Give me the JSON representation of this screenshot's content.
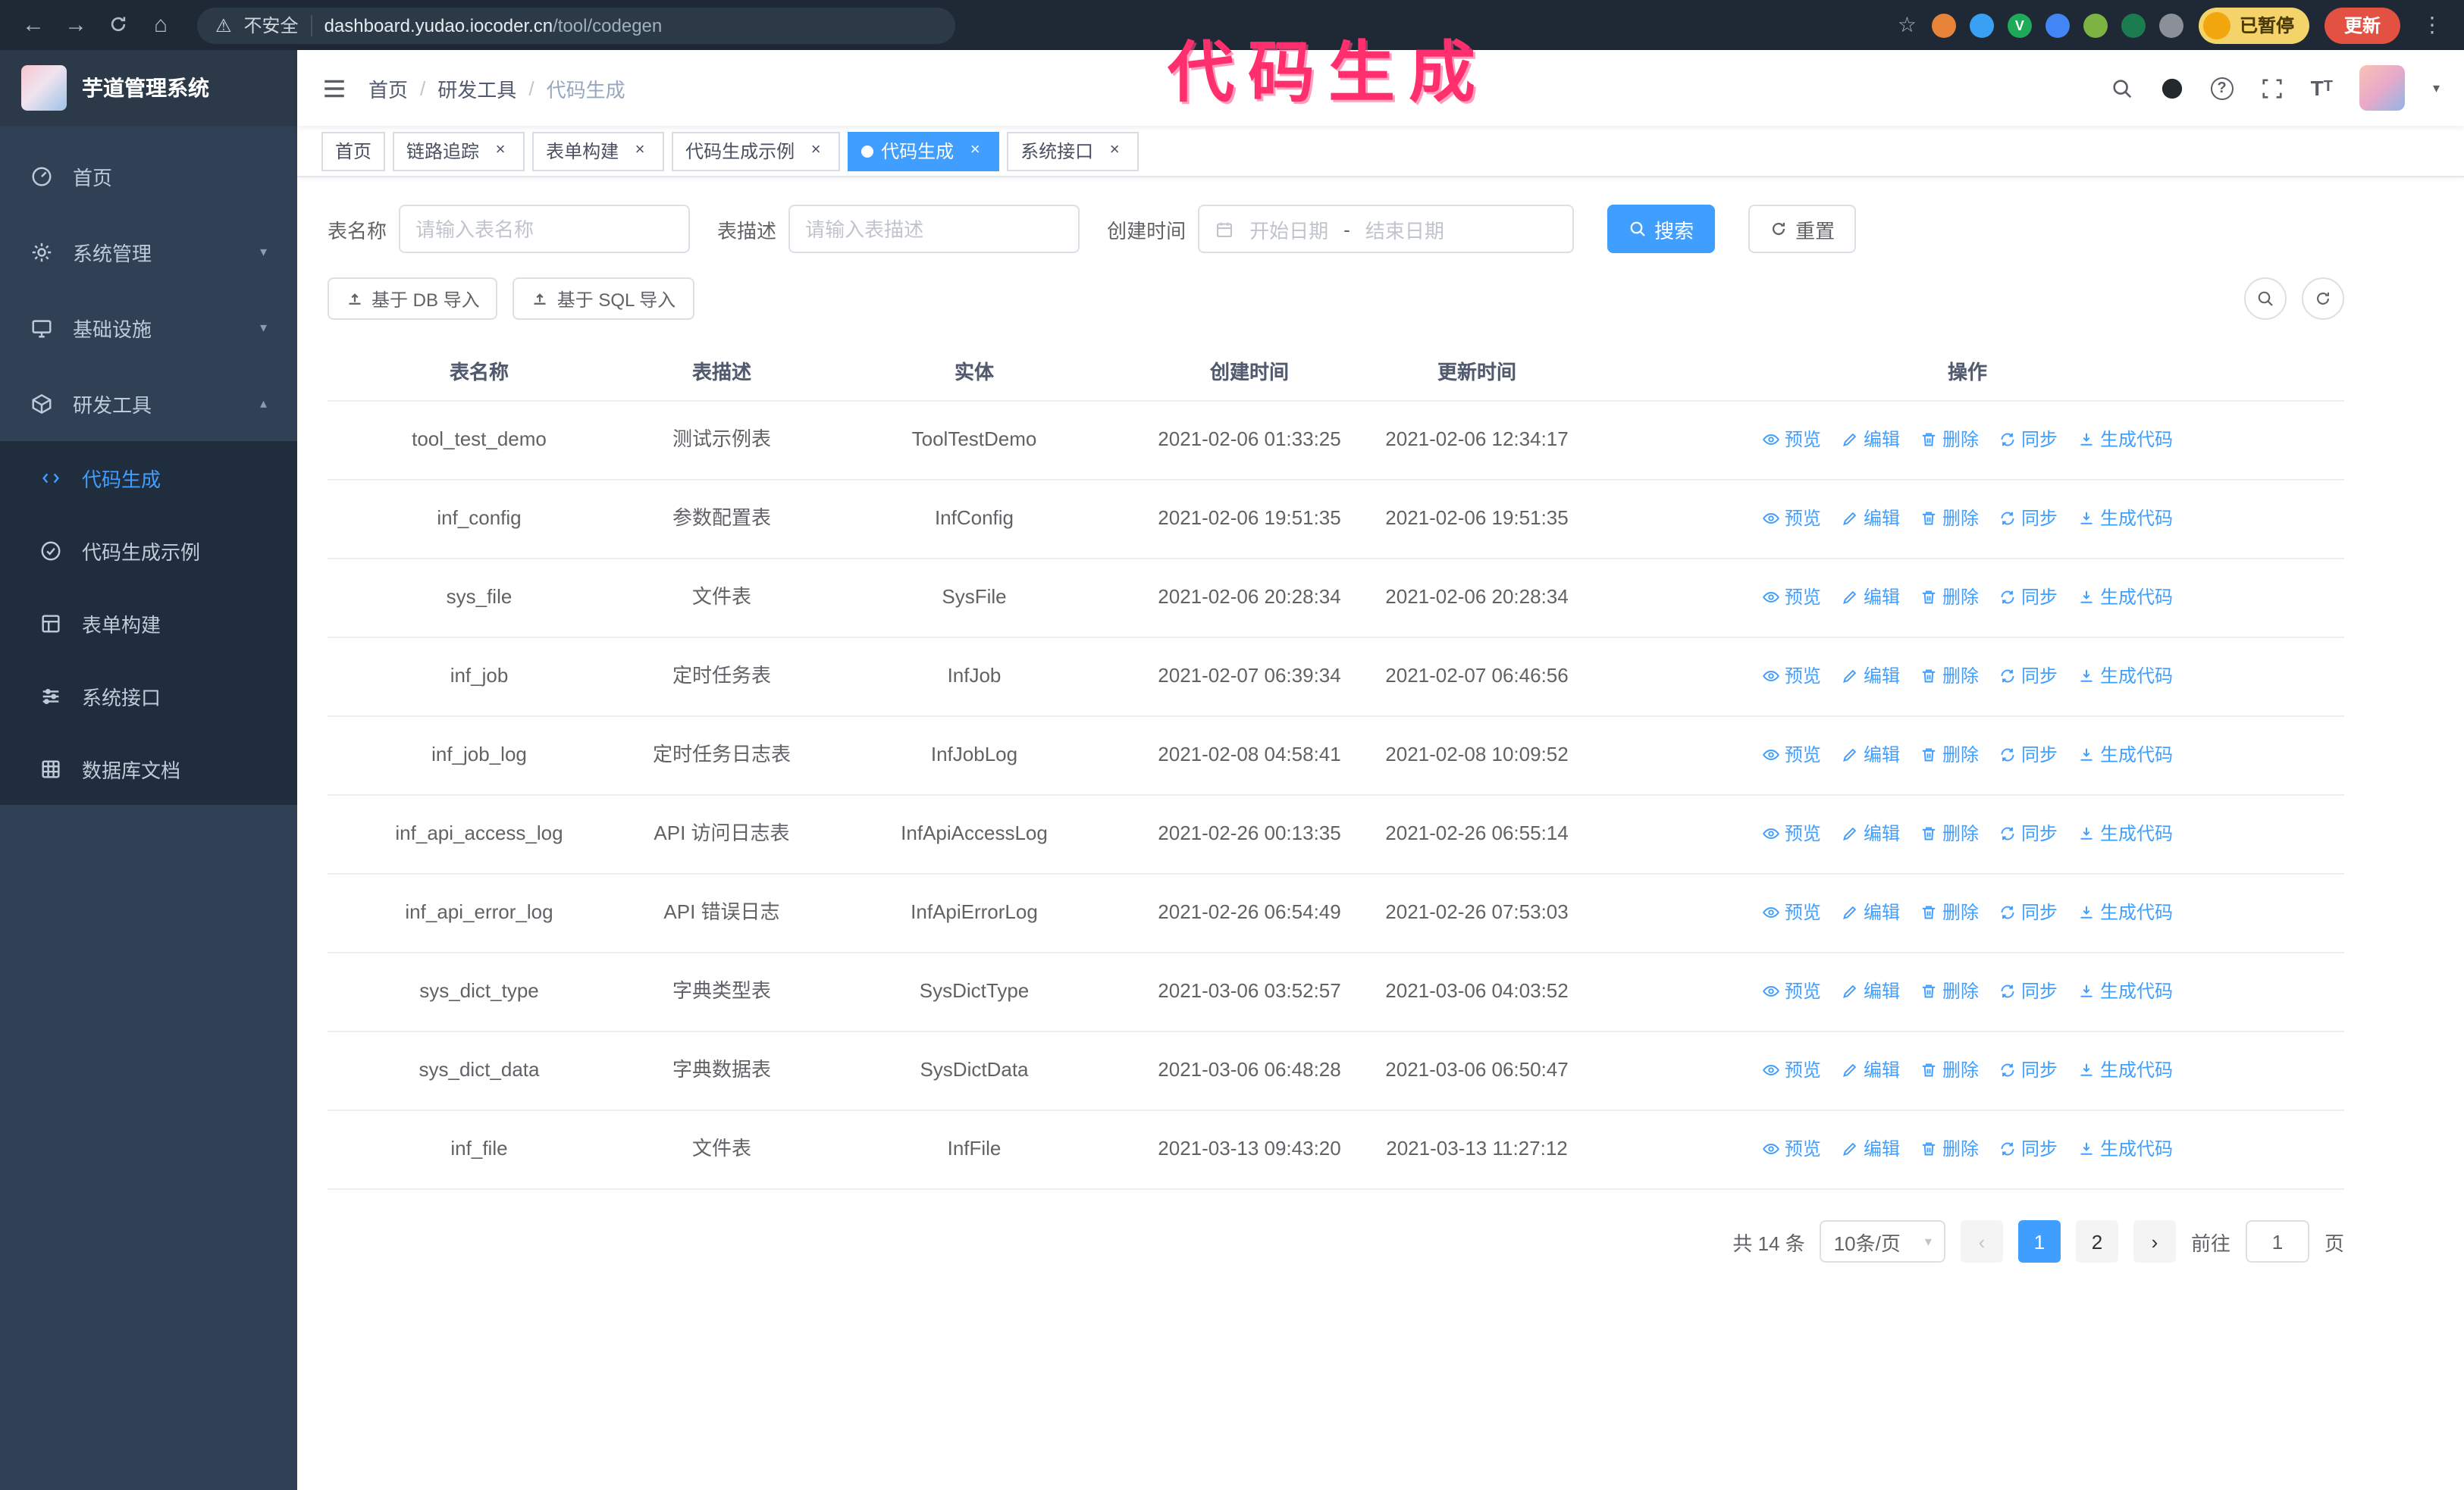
{
  "browser": {
    "security_label": "不安全",
    "url_domain": "dashboard.yudao.iocoder.cn",
    "url_path": "/tool/codegen",
    "extensions": [
      {
        "name": "extension-icon-1",
        "color": "#e8833a",
        "glyph": ""
      },
      {
        "name": "extension-icon-2",
        "color": "#3aa0f3",
        "glyph": ""
      },
      {
        "name": "extension-icon-3",
        "color": "#1faa59",
        "glyph": "V"
      },
      {
        "name": "extension-icon-4",
        "color": "#4285f4",
        "glyph": ""
      },
      {
        "name": "extension-icon-5",
        "color": "#7cb342",
        "glyph": ""
      },
      {
        "name": "extension-icon-6",
        "color": "#1b7d4f",
        "glyph": ""
      },
      {
        "name": "extension-icon-7",
        "color": "#8a8f98",
        "glyph": ""
      }
    ],
    "paused_badge": "已暂停",
    "update_button": "更新"
  },
  "annotation": {
    "title": "代码生成",
    "color": "#ff2f6e"
  },
  "sidebar": {
    "logo_title": "芋道管理系统",
    "items": [
      {
        "label": "首页"
      },
      {
        "label": "系统管理"
      },
      {
        "label": "基础设施"
      },
      {
        "label": "研发工具"
      }
    ],
    "subitems": [
      {
        "label": "代码生成"
      },
      {
        "label": "代码生成示例"
      },
      {
        "label": "表单构建"
      },
      {
        "label": "系统接口"
      },
      {
        "label": "数据库文档"
      }
    ]
  },
  "header": {
    "breadcrumb": [
      "首页",
      "研发工具",
      "代码生成"
    ]
  },
  "tabs": [
    {
      "label": "首页"
    },
    {
      "label": "链路追踪"
    },
    {
      "label": "表单构建"
    },
    {
      "label": "代码生成示例"
    },
    {
      "label": "代码生成"
    },
    {
      "label": "系统接口"
    }
  ],
  "filters": {
    "table_name_label": "表名称",
    "table_name_placeholder": "请输入表名称",
    "table_desc_label": "表描述",
    "table_desc_placeholder": "请输入表描述",
    "create_time_label": "创建时间",
    "date_start_placeholder": "开始日期",
    "date_separator": "-",
    "date_end_placeholder": "结束日期",
    "search_button": "搜索",
    "reset_button": "重置"
  },
  "toolbar": {
    "import_db": "基于 DB 导入",
    "import_sql": "基于 SQL 导入"
  },
  "table": {
    "columns": [
      "表名称",
      "表描述",
      "实体",
      "创建时间",
      "更新时间",
      "操作"
    ],
    "actions": [
      "预览",
      "编辑",
      "删除",
      "同步",
      "生成代码"
    ],
    "rows": [
      {
        "name": "tool_test_demo",
        "desc": "测试示例表",
        "entity": "ToolTestDemo",
        "created": "2021-02-06 01:33:25",
        "updated": "2021-02-06 12:34:17"
      },
      {
        "name": "inf_config",
        "desc": "参数配置表",
        "entity": "InfConfig",
        "created": "2021-02-06 19:51:35",
        "updated": "2021-02-06 19:51:35"
      },
      {
        "name": "sys_file",
        "desc": "文件表",
        "entity": "SysFile",
        "created": "2021-02-06 20:28:34",
        "updated": "2021-02-06 20:28:34"
      },
      {
        "name": "inf_job",
        "desc": "定时任务表",
        "entity": "InfJob",
        "created": "2021-02-07 06:39:34",
        "updated": "2021-02-07 06:46:56"
      },
      {
        "name": "inf_job_log",
        "desc": "定时任务日志表",
        "entity": "InfJobLog",
        "created": "2021-02-08 04:58:41",
        "updated": "2021-02-08 10:09:52"
      },
      {
        "name": "inf_api_access_log",
        "desc": "API 访问日志表",
        "entity": "InfApiAccessLog",
        "created": "2021-02-26 00:13:35",
        "updated": "2021-02-26 06:55:14"
      },
      {
        "name": "inf_api_error_log",
        "desc": "API 错误日志",
        "entity": "InfApiErrorLog",
        "created": "2021-02-26 06:54:49",
        "updated": "2021-02-26 07:53:03"
      },
      {
        "name": "sys_dict_type",
        "desc": "字典类型表",
        "entity": "SysDictType",
        "created": "2021-03-06 03:52:57",
        "updated": "2021-03-06 04:03:52"
      },
      {
        "name": "sys_dict_data",
        "desc": "字典数据表",
        "entity": "SysDictData",
        "created": "2021-03-06 06:48:28",
        "updated": "2021-03-06 06:50:47"
      },
      {
        "name": "inf_file",
        "desc": "文件表",
        "entity": "InfFile",
        "created": "2021-03-13 09:43:20",
        "updated": "2021-03-13 11:27:12"
      }
    ]
  },
  "pagination": {
    "total": "共 14 条",
    "page_size": "10条/页",
    "pages": [
      "1",
      "2"
    ],
    "goto_label": "前往",
    "goto_value": "1",
    "page_label": "页"
  }
}
